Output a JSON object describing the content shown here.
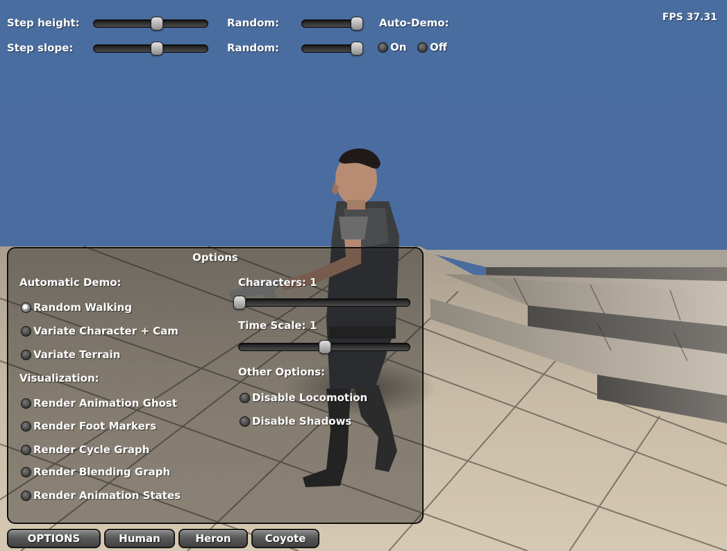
{
  "hud": {
    "fps": "FPS 37.31",
    "step_height_label": "Step height:",
    "step_slope_label": "Step slope:",
    "random_label_1": "Random:",
    "random_label_2": "Random:",
    "auto_demo_label": "Auto-Demo:",
    "auto_demo_on": "On",
    "auto_demo_off": "Off",
    "step_height_value": 0.55,
    "step_slope_value": 0.55,
    "random_1_value": 0.95,
    "random_2_value": 0.95,
    "auto_demo_selected": "none"
  },
  "options": {
    "title": "Options",
    "automatic_demo_label": "Automatic Demo:",
    "demo_modes": [
      {
        "label": "Random Walking",
        "selected": true
      },
      {
        "label": "Variate Character + Cam",
        "selected": false
      },
      {
        "label": "Variate Terrain",
        "selected": false
      }
    ],
    "visualization_label": "Visualization:",
    "visualization_items": [
      {
        "label": "Render Animation Ghost",
        "checked": false
      },
      {
        "label": "Render Foot Markers",
        "checked": false
      },
      {
        "label": "Render Cycle Graph",
        "checked": false
      },
      {
        "label": "Render Blending Graph",
        "checked": false
      },
      {
        "label": "Render Animation States",
        "checked": false
      }
    ],
    "characters_label": "Characters: 1",
    "characters_value": 0.0,
    "time_scale_label": "Time Scale: 1",
    "time_scale_value": 0.5,
    "other_options_label": "Other Options:",
    "other_items": [
      {
        "label": "Disable Locomotion",
        "checked": false
      },
      {
        "label": "Disable Shadows",
        "checked": false
      }
    ]
  },
  "bottom_tabs": [
    "OPTIONS",
    "Human",
    "Heron",
    "Coyote"
  ],
  "colors": {
    "sky": "#4a6b9e",
    "floor_tile": "#c9bba6",
    "grout": "#3e3830",
    "step_top": "#bdb5a8",
    "step_face": "#6f6c68"
  }
}
